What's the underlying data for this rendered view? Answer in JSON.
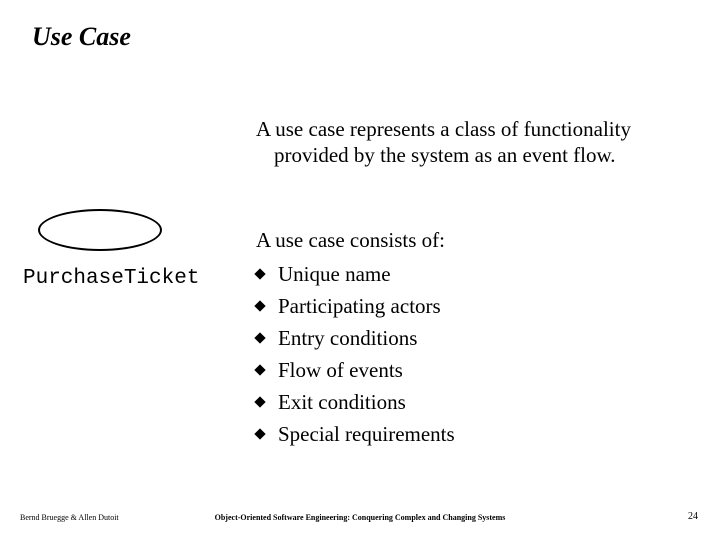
{
  "title": "Use Case",
  "intro": "A use case represents a class of functionality provided by the system as an event flow.",
  "usecase_label": "PurchaseTicket",
  "consists_heading": "A use case consists of:",
  "items": [
    "Unique name",
    "Participating actors",
    "Entry conditions",
    "Flow of events",
    "Exit conditions",
    "Special requirements"
  ],
  "footer": {
    "left": "Bernd Bruegge & Allen Dutoit",
    "center": "Object-Oriented Software Engineering: Conquering Complex and Changing Systems",
    "page": "24"
  }
}
